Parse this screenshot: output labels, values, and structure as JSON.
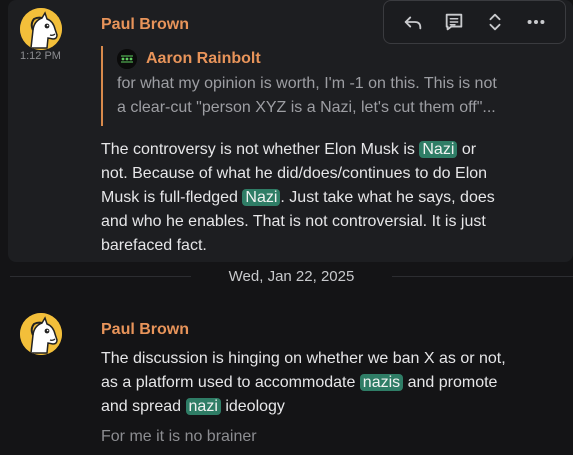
{
  "toolbar": {
    "reply_icon": "reply-icon",
    "thread_icon": "thread-icon",
    "expand_icon": "expand-icon",
    "more_icon": "more-options-icon"
  },
  "messages": [
    {
      "sender": "Paul Brown",
      "timestamp": "1:12 PM",
      "reply": {
        "author": "Aaron Rainbolt",
        "lines": [
          "for what my opinion is worth, I'm -1 on this. This is not",
          "a clear-cut \"person XYZ is a Nazi, let's cut them off\"..."
        ]
      },
      "body": {
        "l1_a": "The controversy is not whether Elon Musk is ",
        "l1_pill": "Nazi",
        "l1_b": " or",
        "l2_a": "not. Because of what he  did/does/continues to do Elon",
        "l3_a": "Musk is full-fledged ",
        "l3_pill": "Nazi",
        "l3_b": ". Just take what he says, does",
        "l4_a": "and who he enables. That is not controversial. It is just",
        "l5_a": "barefaced fact."
      }
    },
    {
      "sender": "Paul Brown",
      "body": {
        "l1_a": "The discussion is hinging on whether we ban X as or not,",
        "l2_a": "as a platform used to accommodate ",
        "l2_pill": "nazis",
        "l2_b": " and promote",
        "l3_a": "and spread ",
        "l3_pill": "nazi",
        "l3_b": " ideology"
      },
      "followup": "For me it is no brainer"
    }
  ],
  "date_separator": "Wed, Jan 22, 2025",
  "colors": {
    "background": "#141416",
    "hover_background": "#1d1e21",
    "sender": "#e8945a",
    "highlight_pill": "#2f7d66",
    "avatar": "#f3bf3a"
  }
}
